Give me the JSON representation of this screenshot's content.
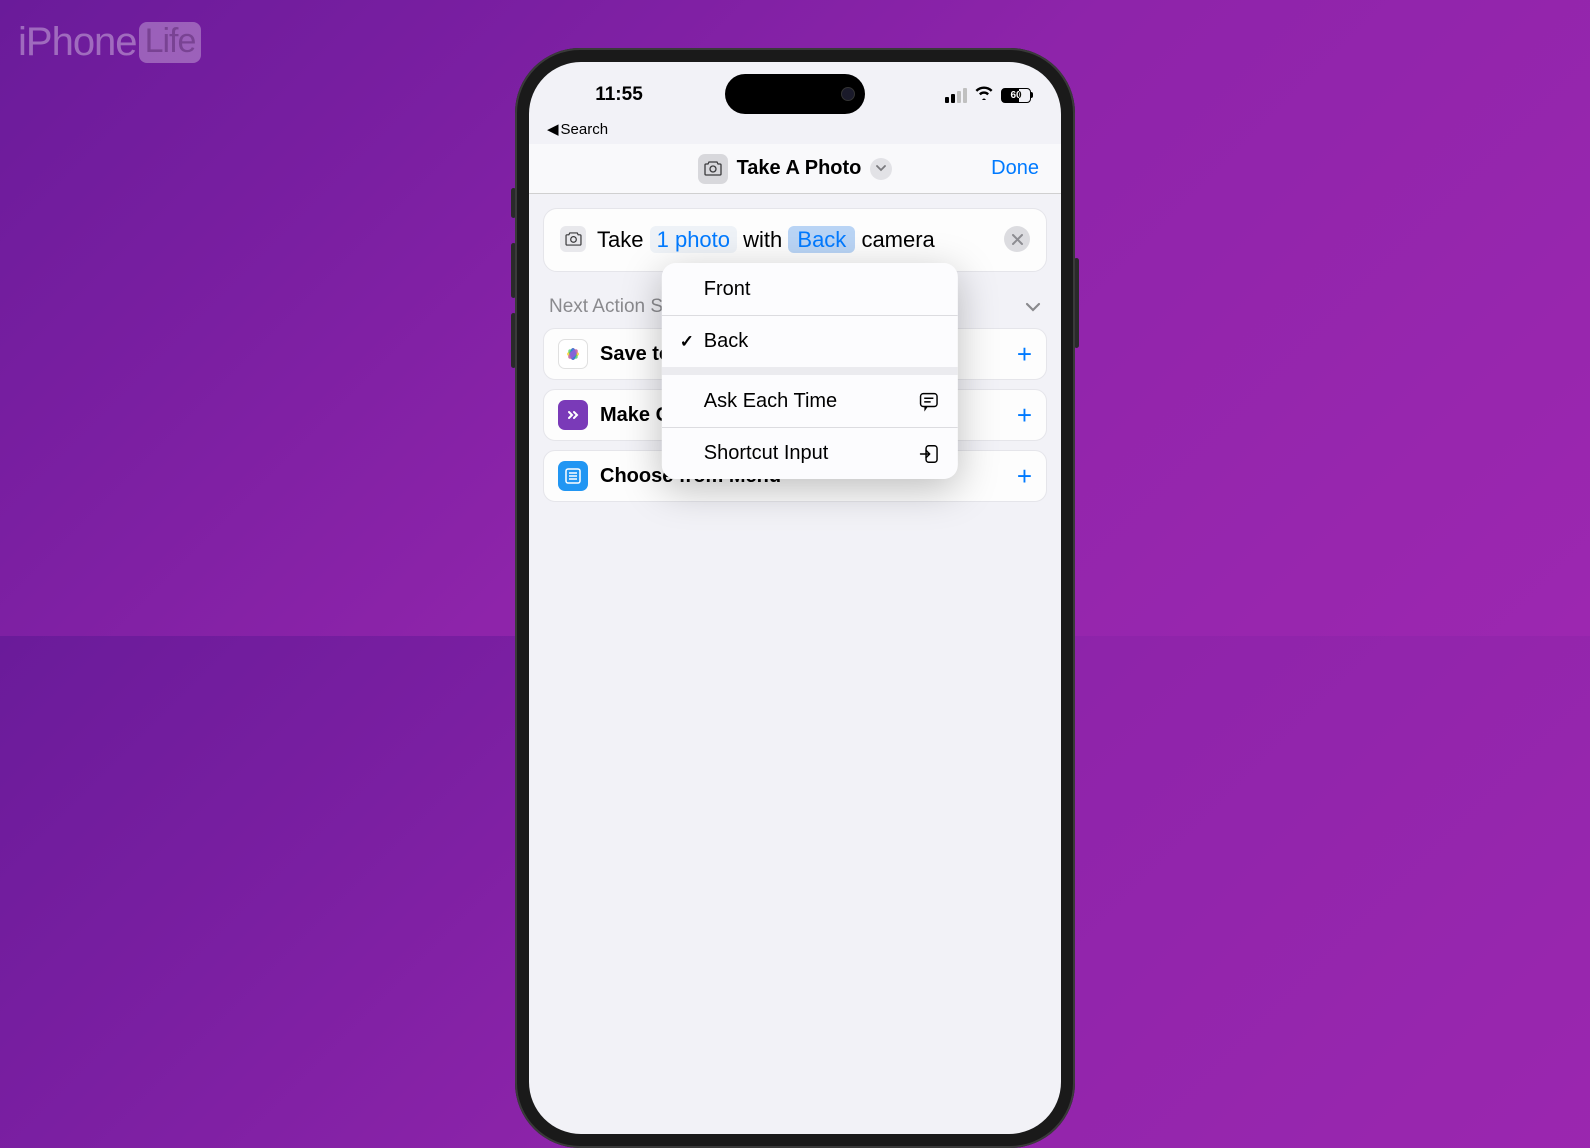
{
  "watermark": {
    "brand": "iPhone",
    "sub": "Life"
  },
  "status": {
    "time": "11:55",
    "battery": "60"
  },
  "back_link": "Search",
  "nav": {
    "title": "Take A Photo",
    "done": "Done"
  },
  "action": {
    "take": "Take",
    "count": "1 photo",
    "with": "with",
    "camera_sel": "Back",
    "camera_word": "camera"
  },
  "section_header": "Next Action Suggestions",
  "suggestions": [
    {
      "label": "Save to Photo Album",
      "icon": "photos"
    },
    {
      "label": "Make GIF",
      "icon": "gif"
    },
    {
      "label": "Choose from Menu",
      "icon": "menu"
    }
  ],
  "popup": {
    "front": "Front",
    "back": "Back",
    "ask": "Ask Each Time",
    "shortcut": "Shortcut Input"
  }
}
